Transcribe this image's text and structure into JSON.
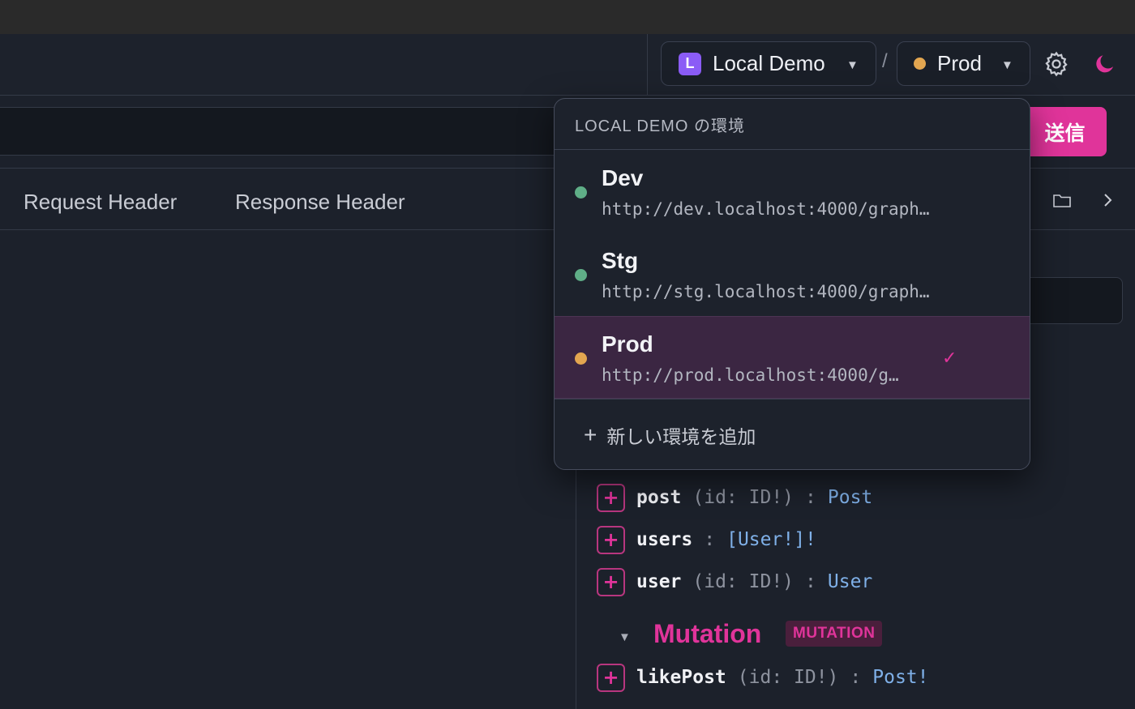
{
  "topbar": {
    "workspace": {
      "badge": "L",
      "label": "Local Demo"
    },
    "separator": "/",
    "environment": {
      "label": "Prod",
      "dot_color": "#e3a650"
    }
  },
  "request": {
    "send_label": "送信"
  },
  "tabs": [
    {
      "label": "Request Header"
    },
    {
      "label": "Response Header"
    }
  ],
  "env_menu": {
    "header": "LOCAL DEMO の環境",
    "items": [
      {
        "name": "Dev",
        "url": "http://dev.localhost:4000/graph…",
        "dot_color": "#5fae87",
        "selected": false
      },
      {
        "name": "Stg",
        "url": "http://stg.localhost:4000/graph…",
        "dot_color": "#5fae87",
        "selected": false
      },
      {
        "name": "Prod",
        "url": "http://prod.localhost:4000/g…",
        "dot_color": "#e3a650",
        "selected": true,
        "check": "✓"
      }
    ],
    "add_label": "新しい環境を追加",
    "add_icon": "+"
  },
  "schema": {
    "query_fields": [
      {
        "name": "post",
        "args": "(id: ID!)",
        "type": "Post"
      },
      {
        "name": "users",
        "args": "",
        "type": "[User!]!"
      },
      {
        "name": "user",
        "args": "(id: ID!)",
        "type": "User"
      }
    ],
    "mutation_section": {
      "title": "Mutation",
      "badge": "MUTATION"
    },
    "mutation_fields": [
      {
        "name": "likePost",
        "args": "(id: ID!)",
        "type": "Post!"
      }
    ],
    "colon": ":",
    "add_icon": "+"
  },
  "colors": {
    "accent": "#e0349a",
    "background": "#1c212b"
  }
}
